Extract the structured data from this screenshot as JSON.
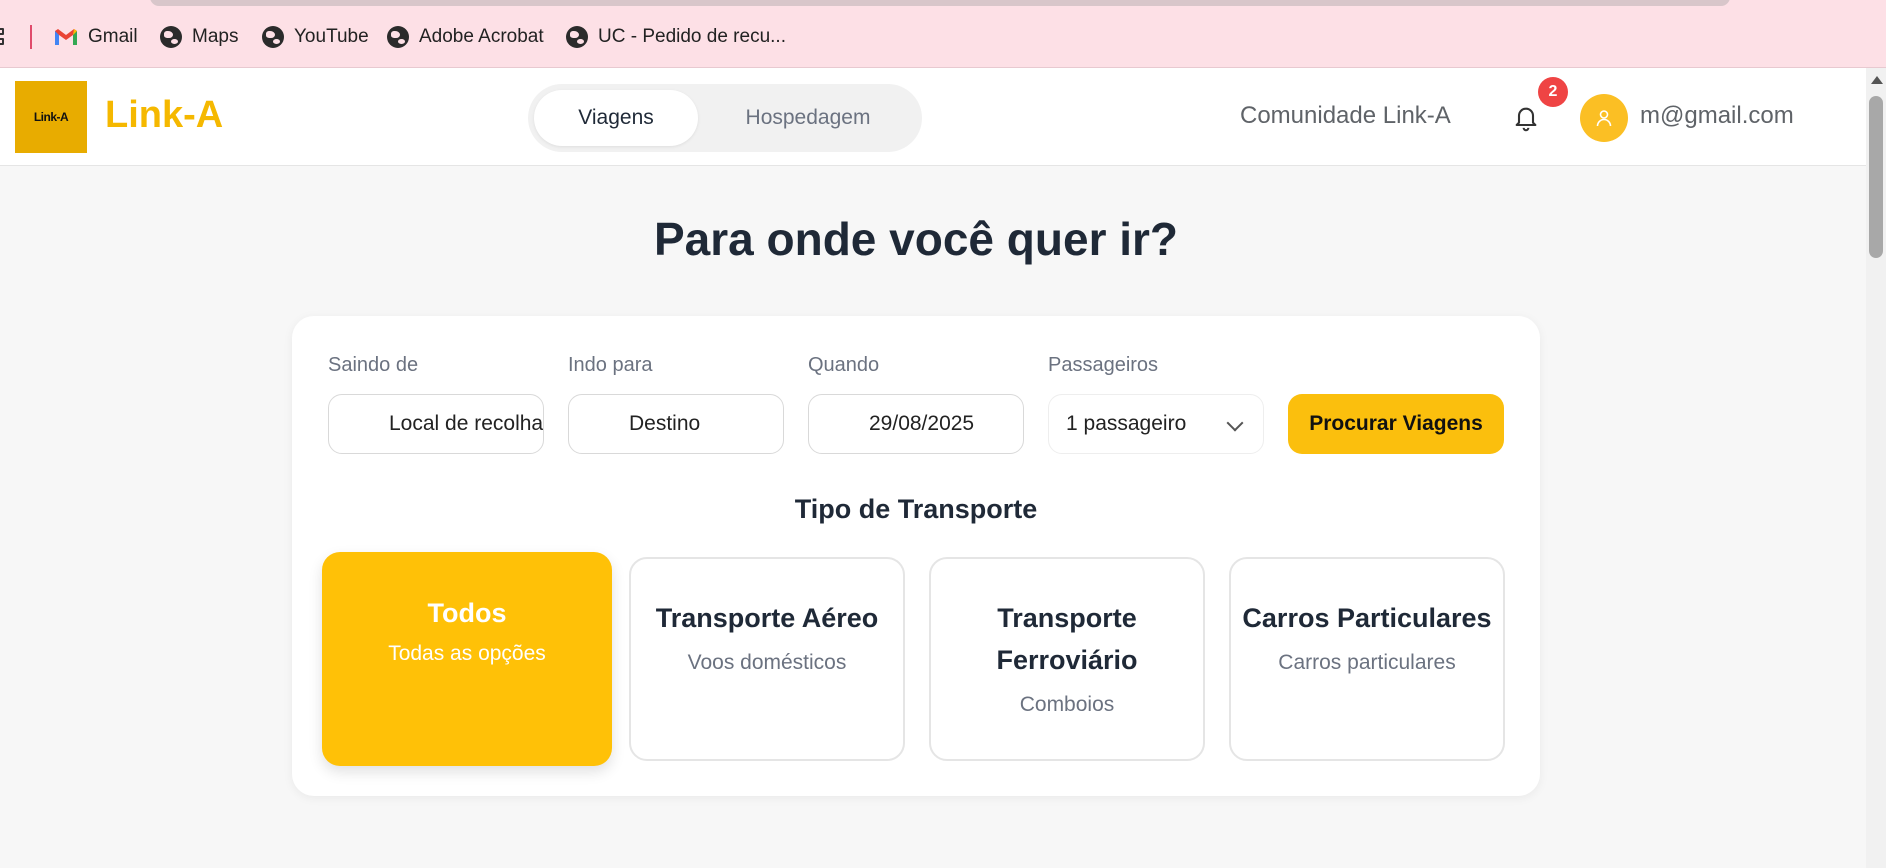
{
  "bookmarks": {
    "items": [
      {
        "label": "Gmail",
        "icon": "gmail-icon"
      },
      {
        "label": "Maps",
        "icon": "globe-icon"
      },
      {
        "label": "YouTube",
        "icon": "globe-icon"
      },
      {
        "label": "Adobe Acrobat",
        "icon": "globe-icon"
      },
      {
        "label": "UC - Pedido de recu...",
        "icon": "globe-icon"
      }
    ]
  },
  "header": {
    "logo_text": "Link-A",
    "brand": "Link-A",
    "tabs": [
      {
        "label": "Viagens",
        "active": true
      },
      {
        "label": "Hospedagem",
        "active": false
      }
    ],
    "community_link": "Comunidade Link-A",
    "notification_count": "2",
    "user_email": "m@gmail.com"
  },
  "main": {
    "title": "Para onde você quer ir?",
    "search": {
      "from_label": "Saindo de",
      "from_value": "Local de recolha",
      "to_label": "Indo para",
      "to_value": "Destino",
      "date_label": "Quando",
      "date_value": "29/08/2025",
      "passengers_label": "Passageiros",
      "passengers_value": "1 passageiro",
      "button": "Procurar Viagens"
    },
    "transport_title": "Tipo de Transporte",
    "transport_types": [
      {
        "name": "Todos",
        "description": "Todas as opções",
        "selected": true
      },
      {
        "name": "Transporte Aéreo",
        "description": "Voos domésticos",
        "selected": false
      },
      {
        "name": "Transporte Ferroviário",
        "description": "Comboios",
        "selected": false
      },
      {
        "name": "Carros Particulares",
        "description": "Carros particulares",
        "selected": false
      }
    ]
  },
  "colors": {
    "accent": "#fbbf0d",
    "brand": "#f5b800",
    "badge": "#ef4444",
    "bookmarks_bg": "#fde0e6"
  }
}
